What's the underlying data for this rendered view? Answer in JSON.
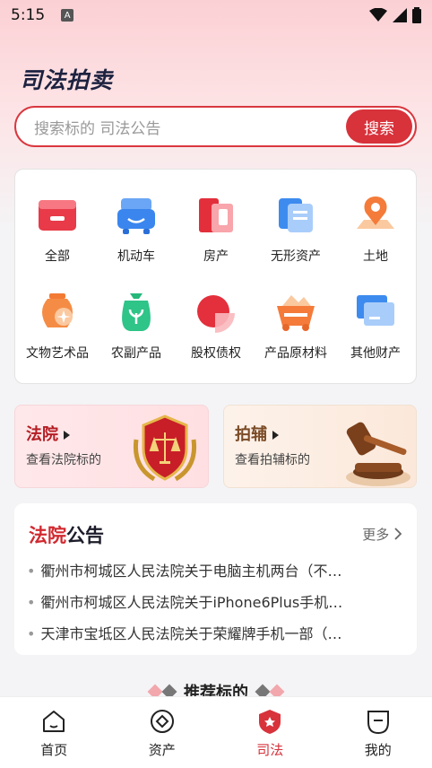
{
  "status_bar": {
    "time": "5:15",
    "badge": "A"
  },
  "app": {
    "title": "司法拍卖"
  },
  "search": {
    "placeholder": "搜索标的 司法公告",
    "button_label": "搜索"
  },
  "categories": [
    {
      "label": "全部",
      "icon": "all-icon"
    },
    {
      "label": "机动车",
      "icon": "car-icon"
    },
    {
      "label": "房产",
      "icon": "house-icon"
    },
    {
      "label": "无形资产",
      "icon": "intangible-asset-icon"
    },
    {
      "label": "土地",
      "icon": "land-icon"
    },
    {
      "label": "文物艺术品",
      "icon": "artwork-icon"
    },
    {
      "label": "农副产品",
      "icon": "farm-product-icon"
    },
    {
      "label": "股权债权",
      "icon": "equity-icon"
    },
    {
      "label": "产品原材料",
      "icon": "raw-material-icon"
    },
    {
      "label": "其他财产",
      "icon": "other-property-icon"
    }
  ],
  "court_cards": [
    {
      "title": "法院",
      "subtitle": "查看法院标的",
      "icon": "court-emblem-icon"
    },
    {
      "title": "拍辅",
      "subtitle": "查看拍辅标的",
      "icon": "gavel-icon"
    }
  ],
  "notices": {
    "title_red": "法院",
    "title_black": "公告",
    "more_label": "更多",
    "items": [
      "衢州市柯城区人民法院关于电脑主机两台（不…",
      "衢州市柯城区人民法院关于iPhone6Plus手机…",
      "天津市宝坻区人民法院关于荣耀牌手机一部（…"
    ]
  },
  "recommend": {
    "title": "推荐标的"
  },
  "bottom_nav": [
    {
      "label": "首页",
      "icon": "home-icon",
      "active": false
    },
    {
      "label": "资产",
      "icon": "asset-icon",
      "active": false
    },
    {
      "label": "司法",
      "icon": "justice-icon",
      "active": true
    },
    {
      "label": "我的",
      "icon": "profile-icon",
      "active": false
    }
  ],
  "colors": {
    "accent": "#d8323b",
    "title": "#1c2240"
  }
}
